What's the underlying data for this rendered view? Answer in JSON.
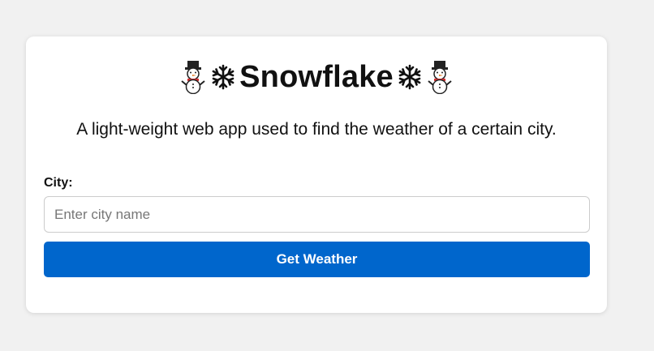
{
  "app": {
    "title": "Snowflake",
    "title_icons": [
      "snowman-icon",
      "snowflake-icon",
      "snowflake-icon",
      "snowman-icon"
    ],
    "subtitle": "A light-weight web app used to find the weather of a certain city."
  },
  "form": {
    "city_label": "City:",
    "city_placeholder": "Enter city name",
    "city_value": "",
    "submit_label": "Get Weather"
  },
  "colors": {
    "background": "#f1f1f1",
    "card": "#ffffff",
    "accent": "#0066cc",
    "text": "#111111"
  }
}
